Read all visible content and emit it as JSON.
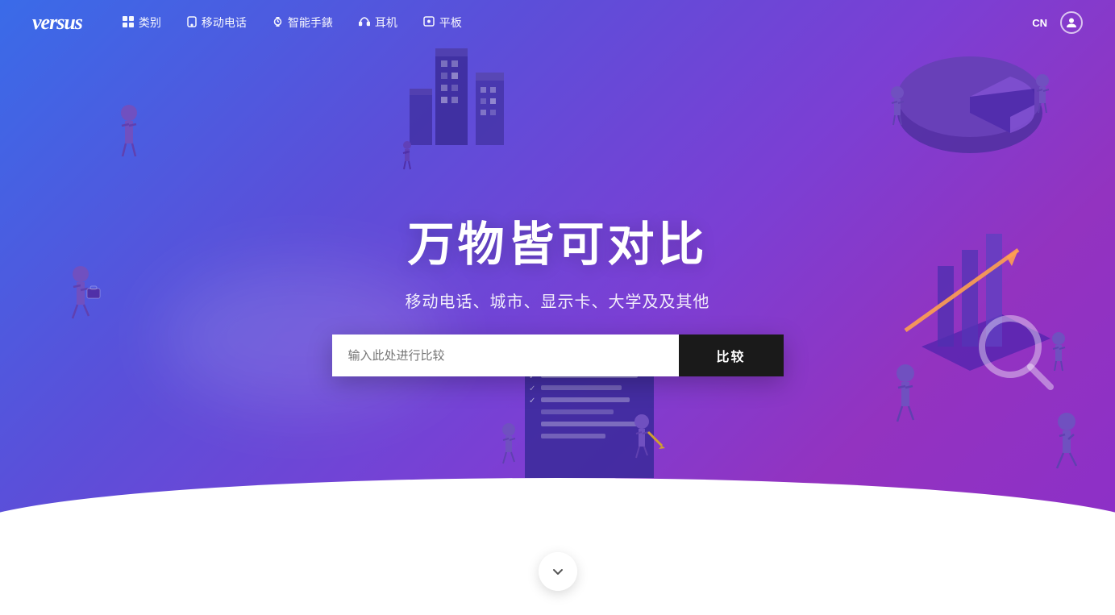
{
  "header": {
    "logo": "versus",
    "nav": [
      {
        "id": "categories",
        "icon": "grid",
        "label": "类别"
      },
      {
        "id": "mobile",
        "icon": "phone",
        "label": "移动电话"
      },
      {
        "id": "smartwatch",
        "icon": "watch",
        "label": "智能手錶"
      },
      {
        "id": "headphones",
        "icon": "headphone",
        "label": "耳机"
      },
      {
        "id": "tablet",
        "icon": "tablet",
        "label": "平板"
      }
    ],
    "lang": "CN",
    "user_icon_label": "user"
  },
  "hero": {
    "title": "万物皆可对比",
    "subtitle": "移动电话、城市、显示卡、大学及及其他",
    "search_placeholder": "输入此处进行比较",
    "search_btn_label": "比较",
    "scroll_down_label": "向下滚动"
  }
}
